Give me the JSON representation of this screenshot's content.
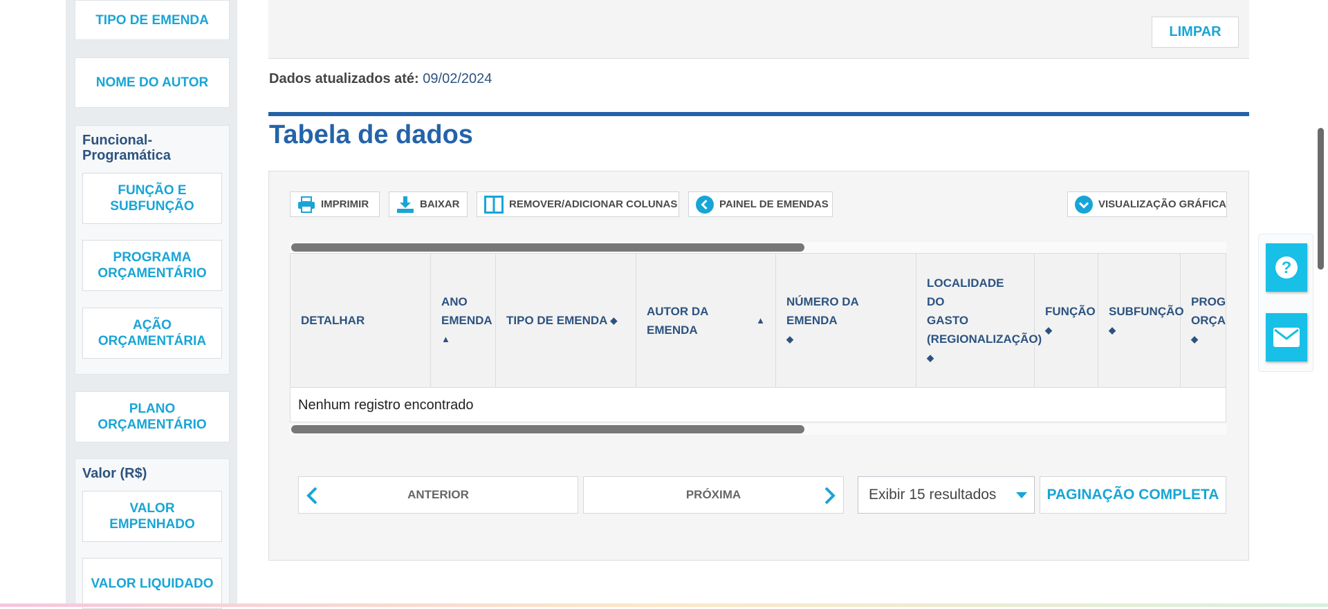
{
  "sidebar": {
    "tipo_emenda": "TIPO DE EMENDA",
    "nome_autor": "NOME DO AUTOR",
    "funcional_title": "Funcional-Programática",
    "funcao_subfuncao": "FUNÇÃO E SUBFUNÇÃO",
    "programa": "PROGRAMA ORÇAMENTÁRIO",
    "acao": "AÇÃO ORÇAMENTÁRIA",
    "plano": "PLANO ORÇAMENTÁRIO",
    "valor_title": "Valor (R$)",
    "valor_empenhado": "VALOR EMPENHADO",
    "valor_liquidado": "VALOR LIQUIDADO"
  },
  "filters": {
    "limpar": "LIMPAR"
  },
  "update": {
    "label": "Dados atualizados até:",
    "date": "09/02/2024"
  },
  "table_section": {
    "title": "Tabela de dados"
  },
  "toolbar": {
    "imprimir": "IMPRIMIR",
    "baixar": "BAIXAR",
    "colunas": "REMOVER/ADICIONAR COLUNAS",
    "painel": "PAINEL DE EMENDAS",
    "grafica": "VISUALIZAÇÃO GRÁFICA"
  },
  "table": {
    "headers": [
      {
        "line1": "DETALHAR",
        "line2": "",
        "line3": ""
      },
      {
        "line1": "ANO",
        "line2": "EMENDA",
        "line3": ""
      },
      {
        "line1": "TIPO DE EMENDA",
        "line2": "",
        "line3": ""
      },
      {
        "line1": "AUTOR DA EMENDA",
        "line2": "",
        "line3": ""
      },
      {
        "line1": "NÚMERO DA EMENDA",
        "line2": "",
        "line3": ""
      },
      {
        "line1": "LOCALIDADE DO",
        "line2": "GASTO",
        "line3": "(REGIONALIZAÇÃO)"
      },
      {
        "line1": "FUNÇÃO",
        "line2": "",
        "line3": ""
      },
      {
        "line1": "SUBFUNÇÃO",
        "line2": "",
        "line3": ""
      },
      {
        "line1": "PROGRA",
        "line2": "ORÇAM",
        "line3": ""
      }
    ],
    "empty_message": "Nenhum registro encontrado"
  },
  "pagination": {
    "anterior": "ANTERIOR",
    "proxima": "PRÓXIMA",
    "select_value": "Exibir 15 resultados",
    "completa": "PAGINAÇÃO COMPLETA"
  },
  "colors": {
    "accent": "#18a5d6",
    "title_blue": "#2463a8",
    "header_blue": "#2c5380"
  },
  "icons": {
    "help": "question-icon",
    "mail": "envelope-icon"
  }
}
